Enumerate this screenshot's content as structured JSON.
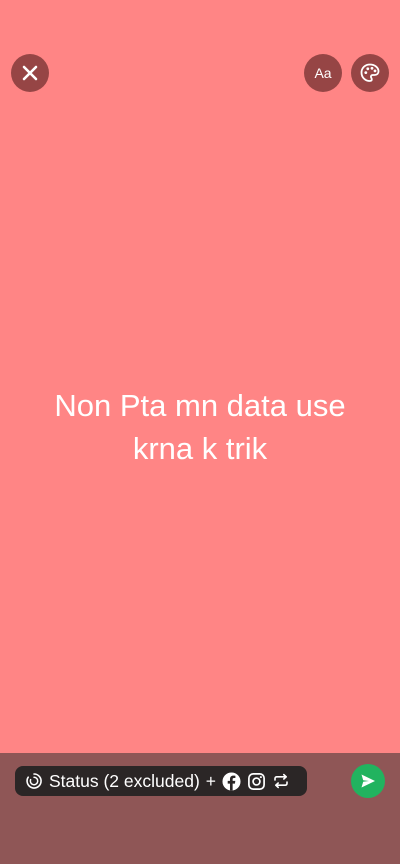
{
  "toolbar": {
    "text_style_label": "Aa"
  },
  "status": {
    "text": "Non Pta mn data use krna k trik",
    "background_color": "#ff8585"
  },
  "audience": {
    "label": "Status (2 excluded)",
    "plus": "+",
    "share_targets": [
      "facebook-icon",
      "instagram-icon",
      "repost-icon"
    ]
  },
  "colors": {
    "send": "#21b35f",
    "bottom_bar": "#8f5656",
    "pill": "#2b2626"
  }
}
